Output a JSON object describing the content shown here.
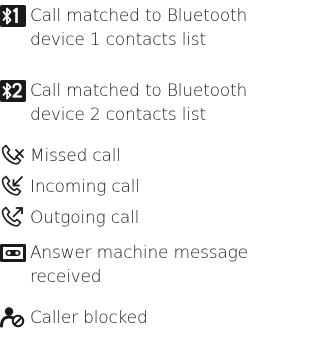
{
  "legend": {
    "items": [
      {
        "icon": "bluetooth-device-1-icon",
        "line1": "Call matched to Bluetooth",
        "line2": "device 1 contacts list"
      },
      {
        "icon": "bluetooth-device-2-icon",
        "line1": "Call matched to Bluetooth",
        "line2": "device 2 contacts list"
      },
      {
        "icon": "missed-call-icon",
        "line1": "Missed call"
      },
      {
        "icon": "incoming-call-icon",
        "line1": "Incoming call"
      },
      {
        "icon": "outgoing-call-icon",
        "line1": "Outgoing call"
      },
      {
        "icon": "answer-machine-icon",
        "line1": "Answer machine message",
        "line2": "received"
      },
      {
        "icon": "caller-blocked-icon",
        "line1": "Caller blocked"
      }
    ]
  }
}
